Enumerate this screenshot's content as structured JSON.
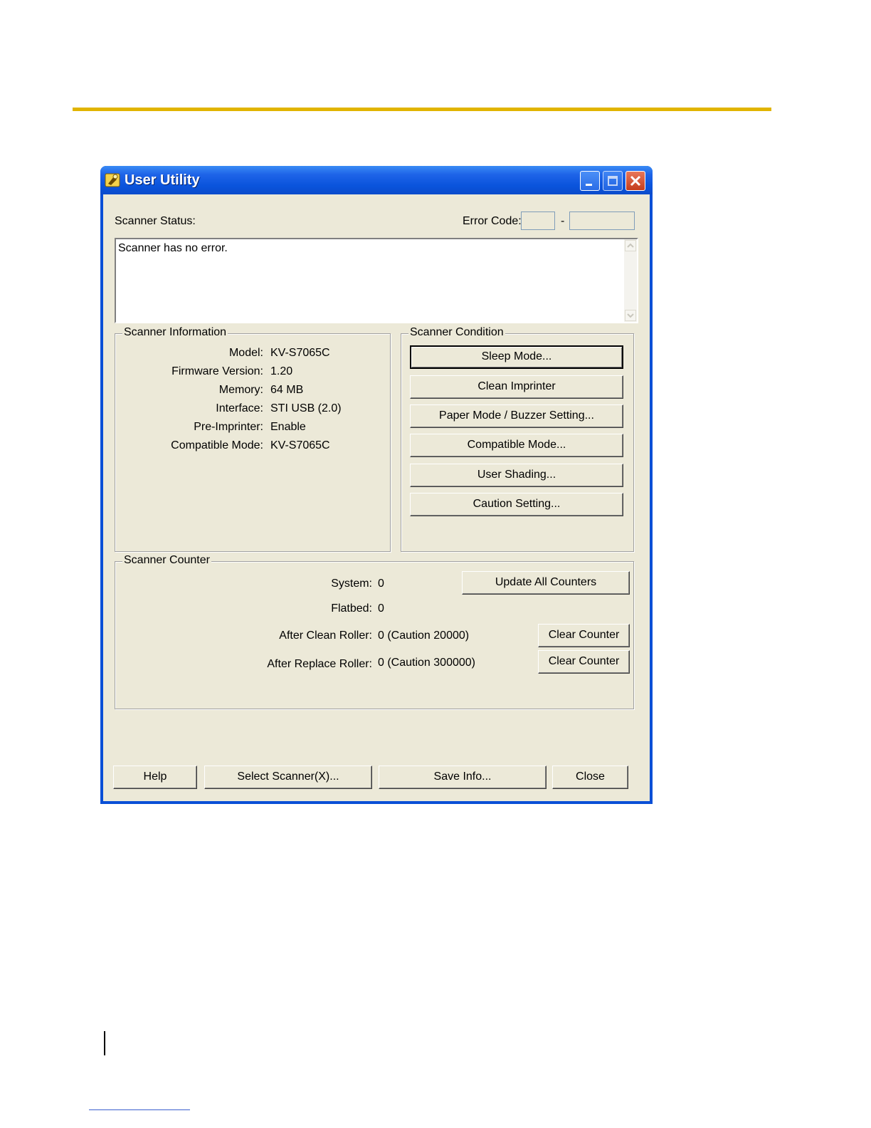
{
  "window": {
    "title": "User Utility"
  },
  "status": {
    "label": "Scanner Status:",
    "error_code_label": "Error Code:",
    "error_code_separator": "-",
    "message": "Scanner has no error."
  },
  "scanner_info": {
    "title": "Scanner Information",
    "rows": [
      {
        "label": "Model:",
        "value": "KV-S7065C"
      },
      {
        "label": "Firmware Version:",
        "value": "1.20"
      },
      {
        "label": "Memory:",
        "value": "64 MB"
      },
      {
        "label": "Interface:",
        "value": "STI USB (2.0)"
      },
      {
        "label": "Pre-Imprinter:",
        "value": "Enable"
      },
      {
        "label": "Compatible Mode:",
        "value": "KV-S7065C"
      }
    ]
  },
  "scanner_condition": {
    "title": "Scanner Condition",
    "buttons": [
      "Sleep Mode...",
      "Clean Imprinter",
      "Paper Mode / Buzzer Setting...",
      "Compatible Mode...",
      "User Shading...",
      "Caution Setting..."
    ]
  },
  "scanner_counter": {
    "title": "Scanner Counter",
    "update_all_label": "Update All Counters",
    "clear_counter_label": "Clear Counter",
    "rows": [
      {
        "label": "System:",
        "value": "0"
      },
      {
        "label": "Flatbed:",
        "value": "0"
      },
      {
        "label": "After Clean Roller:",
        "value": "0 (Caution 20000)"
      },
      {
        "label": "After Replace Roller:",
        "value": "0 (Caution 300000)"
      }
    ]
  },
  "footer": {
    "help": "Help",
    "select_scanner": "Select Scanner(X)...",
    "save_info": "Save Info...",
    "close": "Close"
  }
}
